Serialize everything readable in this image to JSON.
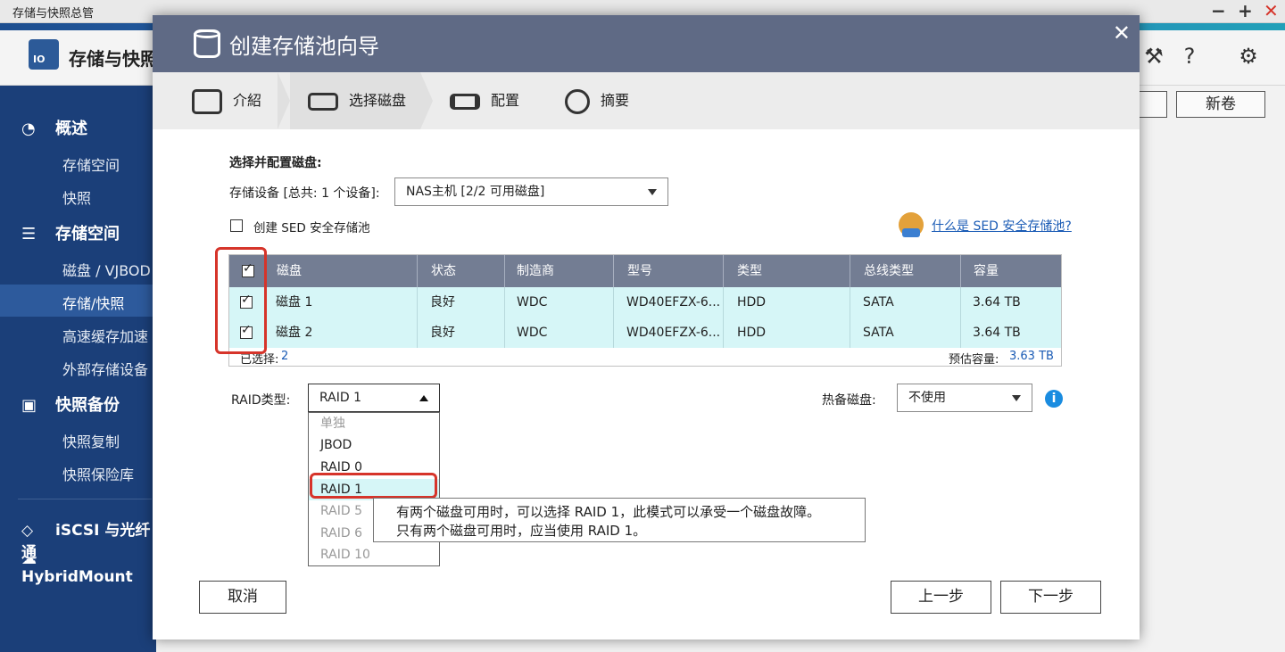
{
  "window": {
    "title": "存储与快照总管",
    "controls": [
      "−",
      "+",
      "✕"
    ]
  },
  "app": {
    "title": "存储与快照"
  },
  "sidebar": {
    "sections": [
      {
        "label": "概述",
        "icon": "gauge-icon",
        "items": [
          "存储空间",
          "快照"
        ]
      },
      {
        "label": "存储空间",
        "icon": "database-icon",
        "items": [
          "磁盘 / VJBOD",
          "存储/快照",
          "高速缓存加速",
          "外部存储设备"
        ]
      },
      {
        "label": "快照备份",
        "icon": "camera-icon",
        "items": [
          "快照复制",
          "快照保险库"
        ]
      }
    ],
    "bottom": [
      {
        "label": "iSCSI 与光纤通",
        "icon": "iscsi-icon"
      },
      {
        "label": "HybridMount",
        "icon": "cloud-icon"
      }
    ],
    "active_item": "存储/快照"
  },
  "background": {
    "new_volume_label": "新卷"
  },
  "dialog": {
    "title": "创建存储池向导",
    "steps": [
      "介紹",
      "选择磁盘",
      "配置",
      "摘要"
    ],
    "active_step": "选择磁盘",
    "section_title": "选择并配置磁盘:",
    "device_label": "存储设备 [总共: 1 个设备]:",
    "device_value": "NAS主机 [2/2 可用磁盘]",
    "sed_checkbox_label": "创建 SED 安全存储池",
    "sed_checkbox_checked": false,
    "sed_link": "什么是 SED 安全存储池?",
    "table": {
      "headers": [
        "磁盘",
        "状态",
        "制造商",
        "型号",
        "类型",
        "总线类型",
        "容量"
      ],
      "header_checked": true,
      "rows": [
        {
          "checked": true,
          "cells": [
            "磁盘 1",
            "良好",
            "WDC",
            "WD40EFZX-6...",
            "HDD",
            "SATA",
            "3.64 TB"
          ]
        },
        {
          "checked": true,
          "cells": [
            "磁盘 2",
            "良好",
            "WDC",
            "WD40EFZX-6...",
            "HDD",
            "SATA",
            "3.64 TB"
          ]
        }
      ],
      "selected_label": "已选择:",
      "selected_count": "2",
      "capacity_label": "预估容量:",
      "capacity_value": "3.63 TB"
    },
    "raid": {
      "label": "RAID类型:",
      "value": "RAID 1",
      "options": [
        {
          "label": "单独",
          "enabled": false
        },
        {
          "label": "JBOD",
          "enabled": true
        },
        {
          "label": "RAID 0",
          "enabled": true
        },
        {
          "label": "RAID 1",
          "enabled": true
        },
        {
          "label": "RAID 5",
          "enabled": false
        },
        {
          "label": "RAID 6",
          "enabled": false
        },
        {
          "label": "RAID 10",
          "enabled": false
        }
      ]
    },
    "tooltip": {
      "line1": "有两个磁盘可用时，可以选择 RAID 1，此模式可以承受一个磁盘故障。",
      "line2": "只有两个磁盘可用时，应当使用 RAID 1。"
    },
    "spare": {
      "label": "热备磁盘:",
      "value": "不使用"
    },
    "buttons": {
      "cancel": "取消",
      "back": "上一步",
      "next": "下一步"
    }
  },
  "colors": {
    "sidebar_bg": "#1b3f79",
    "dialog_header": "#5f6a85",
    "table_header": "#737d93",
    "row_highlight": "#d6f6f7",
    "annotation_red": "#d6342a"
  }
}
